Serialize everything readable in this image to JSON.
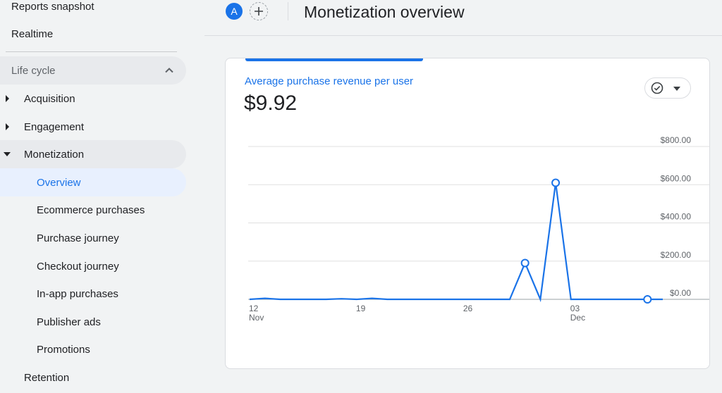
{
  "sidebar": {
    "top_items": [
      "Reports snapshot",
      "Realtime"
    ],
    "section": "Life cycle",
    "groups": [
      "Acquisition",
      "Engagement",
      "Monetization"
    ],
    "subitems": [
      "Overview",
      "Ecommerce purchases",
      "Purchase journey",
      "Checkout journey",
      "In-app purchases",
      "Publisher ads",
      "Promotions"
    ],
    "retention": "Retention"
  },
  "header": {
    "avatar": "A",
    "title": "Monetization overview"
  },
  "card": {
    "metric_label": "Average purchase revenue per user",
    "metric_value": "$9.92"
  },
  "colors": {
    "accent": "#1a73e8",
    "active_bg": "#e8f0fe"
  },
  "chart_data": {
    "type": "line",
    "x": [
      "Nov 12",
      "Nov 13",
      "Nov 14",
      "Nov 15",
      "Nov 16",
      "Nov 17",
      "Nov 18",
      "Nov 19",
      "Nov 20",
      "Nov 21",
      "Nov 22",
      "Nov 23",
      "Nov 24",
      "Nov 25",
      "Nov 26",
      "Nov 27",
      "Nov 28",
      "Nov 29",
      "Nov 30",
      "Dec 1",
      "Dec 2",
      "Dec 3",
      "Dec 4",
      "Dec 5",
      "Dec 6",
      "Dec 7",
      "Dec 8",
      "Dec 9"
    ],
    "values": [
      0,
      5,
      0,
      0,
      0,
      0,
      3,
      0,
      5,
      0,
      0,
      0,
      0,
      0,
      0,
      0,
      0,
      0,
      190,
      0,
      610,
      0,
      0,
      0,
      0,
      0,
      0,
      0
    ],
    "highlight_indices": [
      18,
      20,
      26
    ],
    "ylim": [
      0,
      800
    ],
    "yticks": [
      "$0.00",
      "$200.00",
      "$400.00",
      "$600.00",
      "$800.00"
    ],
    "ytick_values": [
      0,
      200,
      400,
      600,
      800
    ],
    "xticks": [
      {
        "index": 0,
        "day": "12",
        "month": "Nov"
      },
      {
        "index": 7,
        "day": "19",
        "month": ""
      },
      {
        "index": 14,
        "day": "26",
        "month": ""
      },
      {
        "index": 21,
        "day": "03",
        "month": "Dec"
      }
    ],
    "grid": true
  }
}
